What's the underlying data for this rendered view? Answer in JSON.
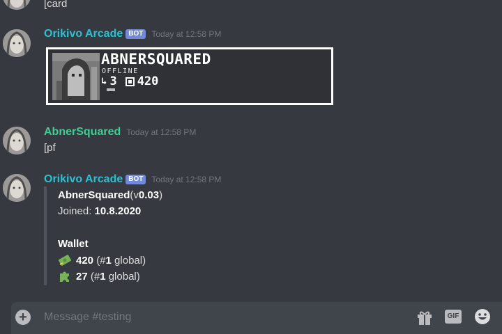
{
  "messages": {
    "top": {
      "text": "[card"
    },
    "bot1": {
      "author": "Orikivo Arcade",
      "tag": "BOT",
      "time": "Today at 12:58 PM"
    },
    "card": {
      "name": "ABNERSQUARED",
      "status": "OFFLINE",
      "level": "3",
      "balance": "420"
    },
    "user": {
      "author": "AbnerSquared",
      "time": "Today at 12:58 PM",
      "text": "[pf"
    },
    "bot2": {
      "author": "Orikivo Arcade",
      "tag": "BOT",
      "time": "Today at 12:58 PM",
      "name": "AbnerSquared",
      "version_open": " (v",
      "version": "0.03",
      "version_close": ")",
      "joined_label": "Joined: ",
      "joined": "10.8.2020",
      "wallet_title": "Wallet",
      "money": "420",
      "money_rank_open": " (#",
      "money_rank": "1",
      "money_rank_close": " global)",
      "tokens": "27",
      "tokens_rank_open": " (#",
      "tokens_rank": "1",
      "tokens_rank_close": " global)"
    }
  },
  "input": {
    "placeholder": "Message #testing",
    "gif": "GIF"
  },
  "colors": {
    "bot_name": "#2ec0d2",
    "user_name": "#3fcf92",
    "bot_tag": "#7289da",
    "background": "#36393f"
  },
  "icons": [
    "add-icon",
    "gift-icon",
    "gif-icon",
    "emoji-icon",
    "money-icon",
    "puzzle-icon"
  ]
}
